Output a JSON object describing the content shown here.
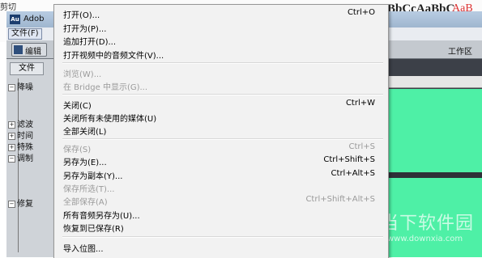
{
  "background": {
    "cut_label": "剪切",
    "styles_preview": "BbCcAaBbC",
    "styles_preview2": "AaB"
  },
  "app": {
    "logo": "Au",
    "title": "Adob",
    "menu_file": "文件(F)",
    "toolbar_btn": "编辑",
    "files_tab": "文件",
    "workspace": "工作区",
    "tree_items": [
      "降噪",
      "滤波",
      "时间",
      "特殊",
      "调制",
      "修复"
    ]
  },
  "menu": {
    "items": [
      {
        "label": "打开(O)...",
        "shortcut": "Ctrl+O",
        "enabled": true
      },
      {
        "label": "打开为(P)...",
        "shortcut": "",
        "enabled": true
      },
      {
        "label": "追加打开(D)...",
        "shortcut": "",
        "enabled": true
      },
      {
        "label": "打开视频中的音频文件(V)...",
        "shortcut": "",
        "enabled": true
      },
      {
        "label": "浏览(W)...",
        "shortcut": "",
        "enabled": false
      },
      {
        "label": "在 Bridge 中显示(G)...",
        "shortcut": "",
        "enabled": false
      },
      {
        "label": "关闭(C)",
        "shortcut": "Ctrl+W",
        "enabled": true
      },
      {
        "label": "关闭所有未使用的媒体(U)",
        "shortcut": "",
        "enabled": true
      },
      {
        "label": "全部关闭(L)",
        "shortcut": "",
        "enabled": true
      },
      {
        "label": "保存(S)",
        "shortcut": "Ctrl+S",
        "enabled": false
      },
      {
        "label": "另存为(E)...",
        "shortcut": "Ctrl+Shift+S",
        "enabled": true
      },
      {
        "label": "另存为副本(Y)...",
        "shortcut": "Ctrl+Alt+S",
        "enabled": true
      },
      {
        "label": "保存所选(T)...",
        "shortcut": "",
        "enabled": false
      },
      {
        "label": "全部保存(A)",
        "shortcut": "Ctrl+Shift+Alt+S",
        "enabled": false
      },
      {
        "label": "所有音频另存为(U)...",
        "shortcut": "",
        "enabled": true
      },
      {
        "label": "恢复到已保存(R)",
        "shortcut": "",
        "enabled": true
      },
      {
        "label": "导入位图...",
        "shortcut": "",
        "enabled": true
      }
    ]
  },
  "watermark": {
    "text": "当下软件园",
    "url": "www.downxia.com"
  }
}
